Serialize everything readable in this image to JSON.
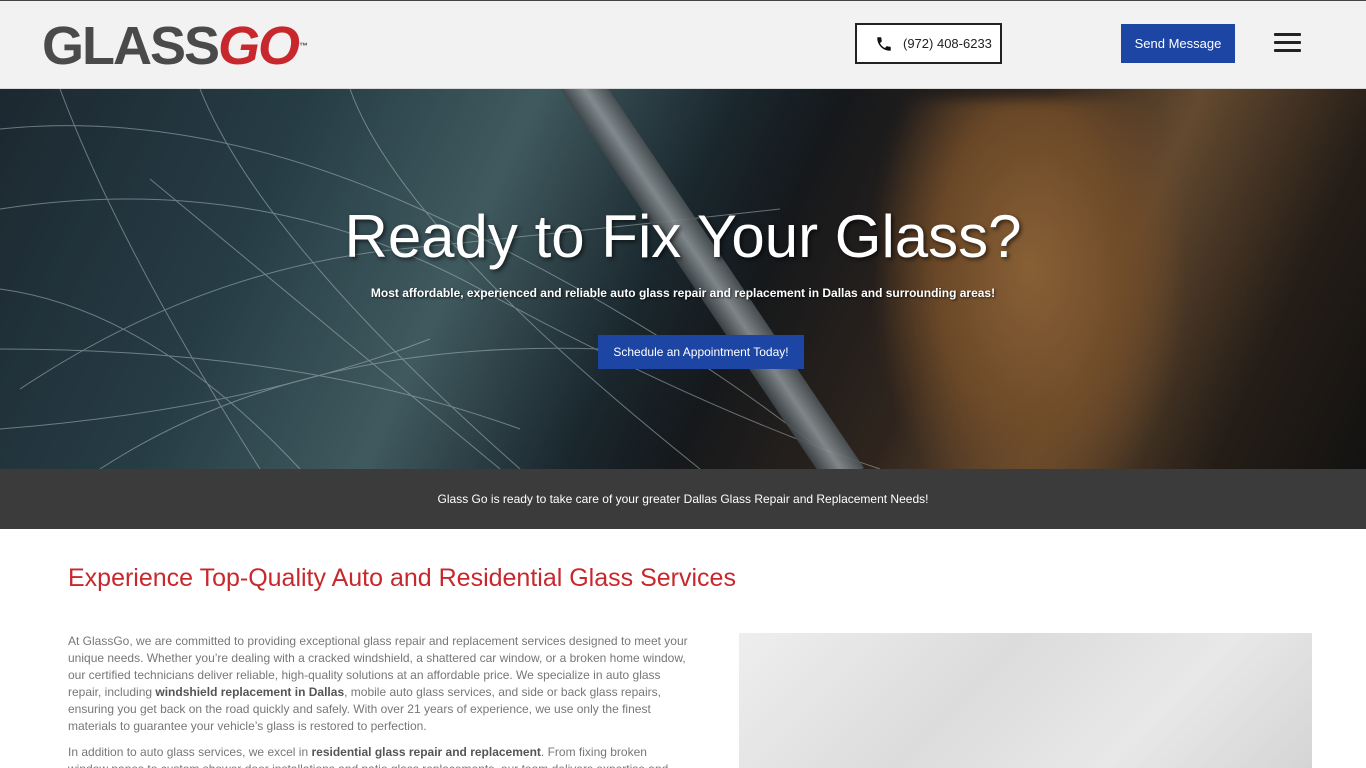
{
  "header": {
    "logo": {
      "glass": "GLASS",
      "go": "GO",
      "tm": "™"
    },
    "phone": "(972) 408-6233",
    "send_message": "Send Message",
    "menu_icon": "hamburger-menu-icon"
  },
  "hero": {
    "title": "Ready to Fix Your Glass?",
    "subtitle": "Most affordable, experienced and reliable auto glass repair and replacement in Dallas and surrounding areas!",
    "cta": "Schedule an Appointment Today!"
  },
  "strip": {
    "text": "Glass Go is ready to take care of your greater Dallas Glass Repair and Replacement Needs!"
  },
  "content": {
    "title": "Experience Top-Quality Auto and Residential Glass Services",
    "p1_a": "At GlassGo, we are committed to providing exceptional glass repair and replacement services designed to meet your unique needs. Whether you’re dealing with a cracked windshield, a shattered car window, or a broken home window, our certified technicians deliver reliable, high-quality solutions at an affordable price. We specialize in auto glass repair, including ",
    "p1_bold": "windshield replacement in Dallas",
    "p1_b": ", mobile auto glass services, and side or back glass repairs, ensuring you get back on the road quickly and safely. With over 21 years of experience, we use only the finest materials to guarantee your vehicle’s glass is restored to perfection.",
    "p2_a": "In addition to auto glass services, we excel in ",
    "p2_bold": "residential glass repair and replacement",
    "p2_b": ". From fixing broken window panes to custom shower door installations and patio glass replacements, our team delivers expertise and precision in"
  },
  "colors": {
    "brand_red": "#c8282d",
    "brand_blue": "#1d45a3",
    "strip_bg": "#3b3b3b",
    "header_bg": "#f2f2f2"
  }
}
